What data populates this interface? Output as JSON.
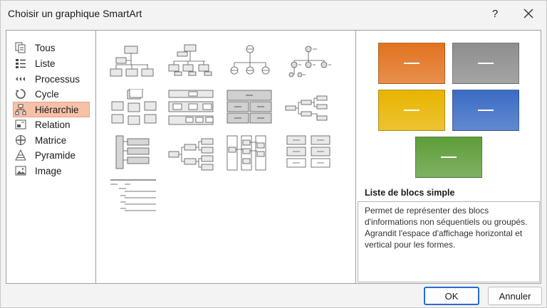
{
  "window": {
    "title": "Choisir un graphique SmartArt",
    "help_label": "?"
  },
  "categories": [
    {
      "label": "Tous",
      "icon": "all-icon",
      "selected": false
    },
    {
      "label": "Liste",
      "icon": "list-icon",
      "selected": false
    },
    {
      "label": "Processus",
      "icon": "process-icon",
      "selected": false
    },
    {
      "label": "Cycle",
      "icon": "cycle-icon",
      "selected": false
    },
    {
      "label": "Hiérarchie",
      "icon": "hierarchy-icon",
      "selected": true
    },
    {
      "label": "Relation",
      "icon": "relationship-icon",
      "selected": false
    },
    {
      "label": "Matrice",
      "icon": "matrix-icon",
      "selected": false
    },
    {
      "label": "Pyramide",
      "icon": "pyramid-icon",
      "selected": false
    },
    {
      "label": "Image",
      "icon": "picture-icon",
      "selected": false
    }
  ],
  "preview": {
    "title": "Liste de blocs simple",
    "description": "Permet de représenter des blocs d'informations non séquentiels ou groupés. Agrandit l'espace d'affichage horizontal et vertical pour les formes.",
    "block_label": "—",
    "colors": [
      "#e2731f",
      "#8e8e8e",
      "#e8b400",
      "#3a6cc4",
      "#5e9e3a"
    ]
  },
  "buttons": {
    "ok": "OK",
    "cancel": "Annuler"
  }
}
